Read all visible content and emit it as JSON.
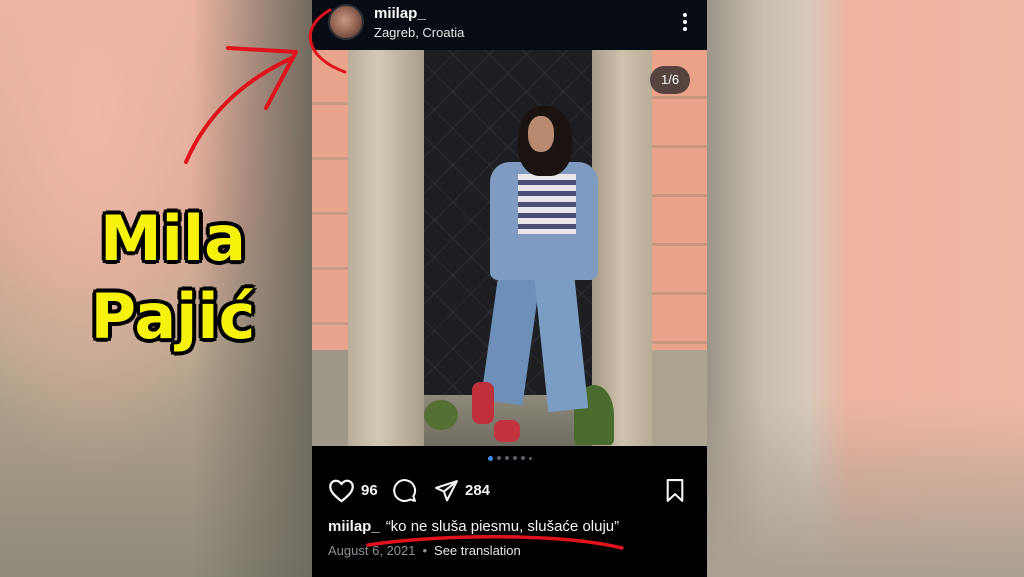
{
  "post": {
    "username": "miilap_",
    "location": "Zagreb, Croatia",
    "image_counter": "1/6",
    "likes": "96",
    "shares": "284",
    "caption_user": "miilap_",
    "caption_text": "“ko ne sluša piesmu, slušaće oluju”",
    "date": "August 6, 2021",
    "separator": "•",
    "see_translation": "See translation"
  },
  "overlay": {
    "name_line1": "Mila",
    "name_line2": "Pajić",
    "label_color": "#f6f20c",
    "annotation_color": "#e0121b"
  },
  "icons": {
    "more": "more-vertical-icon",
    "like": "heart-icon",
    "comment": "comment-bubble-icon",
    "share": "paper-plane-icon",
    "save": "bookmark-icon"
  },
  "carousel": {
    "total": 6,
    "current": 1
  }
}
